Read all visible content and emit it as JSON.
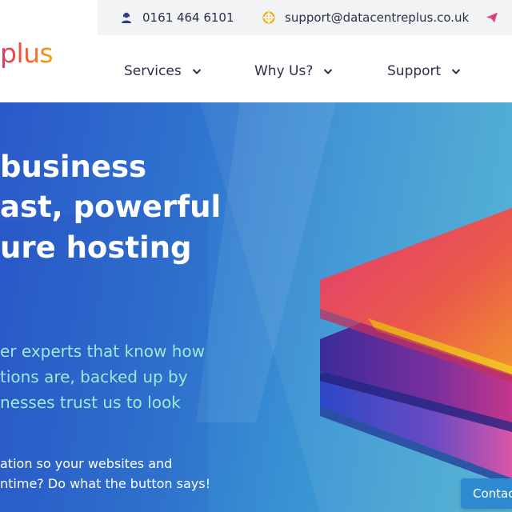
{
  "colors": {
    "brand_orange": "#e8562a",
    "brand_pink": "#d9376e",
    "nav_text": "#2b2f4a",
    "hero_blue": "#2f74cf",
    "hero_teal": "#9de8d6",
    "button_blue": "#2e8ad0"
  },
  "topbar": {
    "phone": {
      "icon": "user-headset-icon",
      "text": "0161 464 6101"
    },
    "email": {
      "icon": "lifebuoy-icon",
      "text": "support@datacentreplus.co.uk"
    },
    "send": {
      "icon": "paper-plane-icon"
    }
  },
  "logo": {
    "text": "plus"
  },
  "nav": {
    "items": [
      {
        "label": "Services"
      },
      {
        "label": "Why Us?"
      },
      {
        "label": "Support"
      }
    ],
    "chevron_icon": "chevron-down-icon"
  },
  "hero": {
    "headline": [
      "business",
      "ast, powerful",
      "ure hosting"
    ],
    "subcopy": [
      "er experts that know how",
      "tions are, backed up by",
      "nesses trust us to look"
    ],
    "smallcopy": [
      "ation so your websites and",
      "ntime? Do what the button says!"
    ],
    "contact_button": "Contac"
  }
}
